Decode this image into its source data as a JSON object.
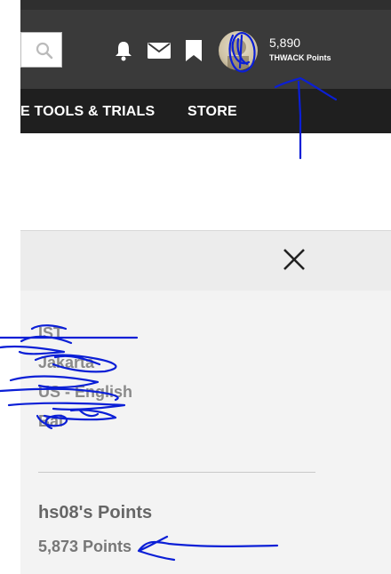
{
  "header": {
    "points_value": "5,890",
    "points_label": "THWACK Points",
    "icons": [
      "search-icon",
      "bell-icon",
      "mail-icon",
      "bookmark-icon",
      "avatar"
    ]
  },
  "nav": {
    "items": [
      {
        "label": "E TOOLS & TRIALS"
      },
      {
        "label": "STORE"
      }
    ]
  },
  "panel": {
    "close_icon": "close-icon",
    "info_lines": [
      "IST",
      "Jakarta",
      "US - English",
      "Bal"
    ],
    "points_title": "hs08's Points",
    "points_value": "5,873 Points"
  },
  "colors": {
    "header_bg": "#3a3a3a",
    "nav_bg": "#1f1f1f",
    "panel_bg": "#f3f3f3",
    "annotation_ink": "#0b1fd6"
  }
}
